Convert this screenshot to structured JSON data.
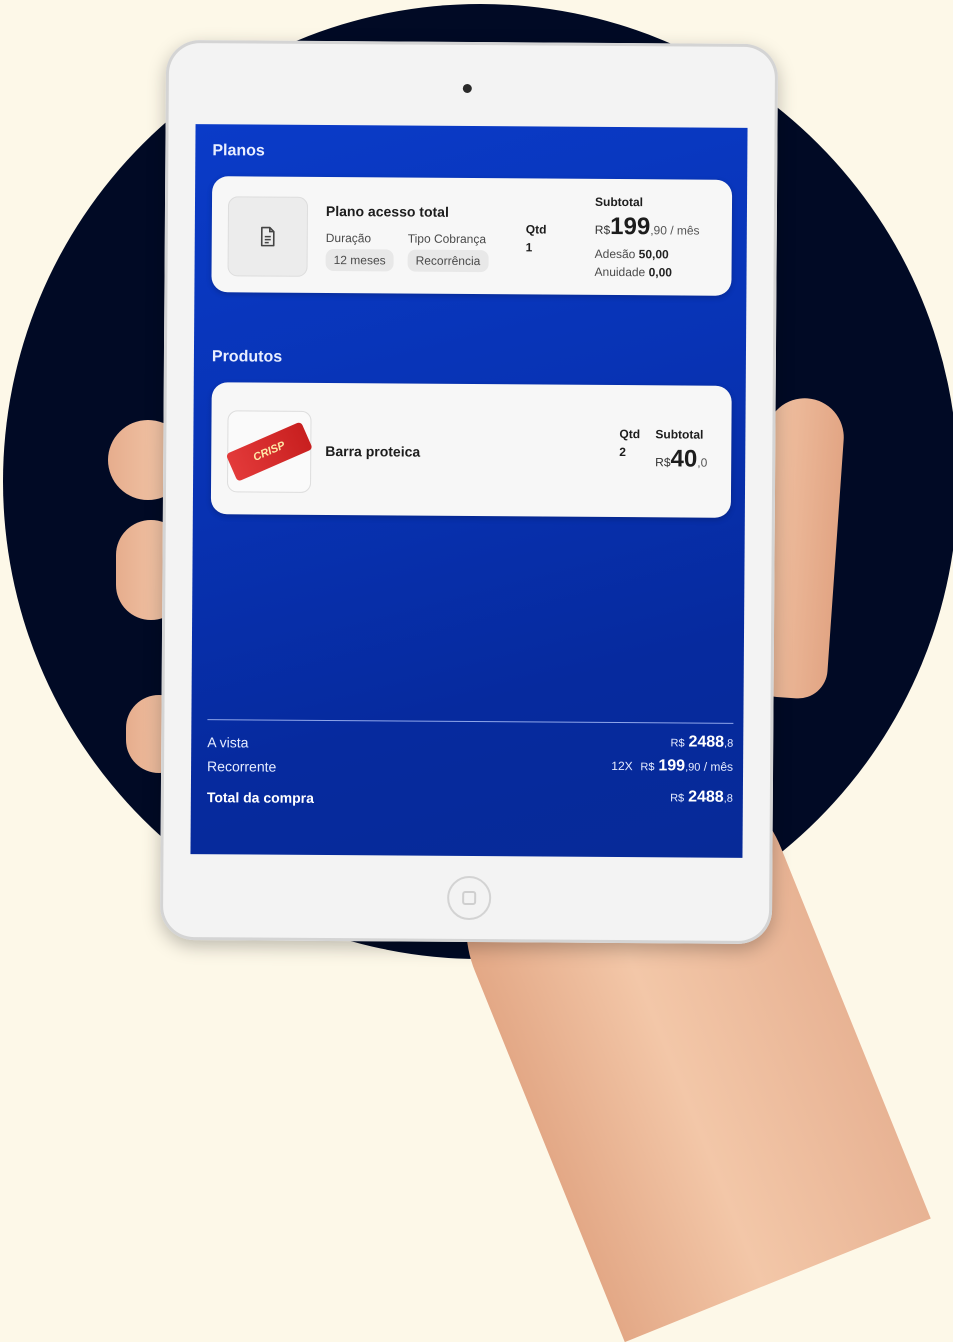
{
  "planos": {
    "title": "Planos",
    "plan": {
      "name": "Plano acesso total",
      "duracao_label": "Duração",
      "duracao_value": "12 meses",
      "tipo_label": "Tipo Cobrança",
      "tipo_value": "Recorrência",
      "qtd_label": "Qtd",
      "qtd_value": "1",
      "subtotal_label": "Subtotal",
      "currency": "R$",
      "price_int": "199",
      "price_dec": ",90",
      "price_unit": " / mês",
      "adesao_label": "Adesão",
      "adesao_value": "50,00",
      "anuidade_label": "Anuidade",
      "anuidade_value": "0,00",
      "icon": "document-icon"
    }
  },
  "produtos": {
    "title": "Produtos",
    "product": {
      "name": "Barra proteica",
      "qtd_label": "Qtd",
      "qtd_value": "2",
      "subtotal_label": "Subtotal",
      "currency": "R$",
      "price_int": "40",
      "price_dec": ",0",
      "image_text": "CRISP"
    }
  },
  "summary": {
    "avista_label": "A vista",
    "avista_currency": "R$",
    "avista_int": "2488",
    "avista_dec": ",8",
    "recorrente_label": "Recorrente",
    "recorrente_times": "12X",
    "recorrente_currency": "R$",
    "recorrente_int": "199",
    "recorrente_dec": ",90",
    "recorrente_unit": " / mês",
    "total_label": "Total da compra",
    "total_currency": "R$",
    "total_int": "2488",
    "total_dec": ",8"
  },
  "colors": {
    "background": "#fdf8e8",
    "circle": "#010a25",
    "screen": "#0833b5"
  }
}
